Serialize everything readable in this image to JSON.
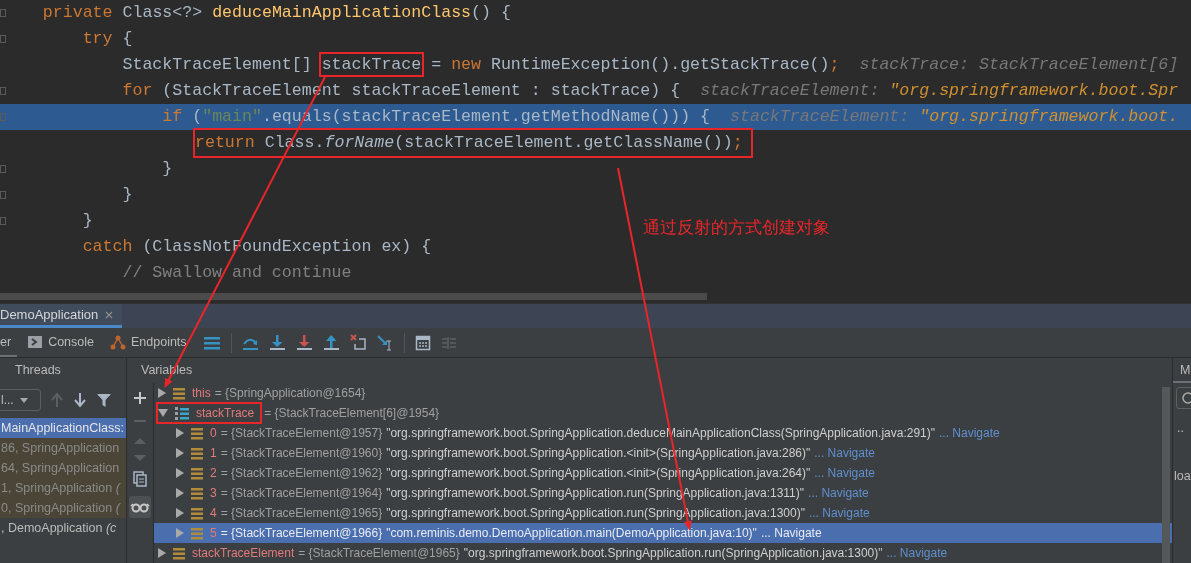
{
  "editor": {
    "lines": [
      {
        "foldable": true,
        "current": false,
        "boxed": false,
        "code": [
          {
            "t": "    private",
            "kind": "keyword"
          },
          {
            "t": " Class<?> ",
            "kind": "plain"
          },
          {
            "t": "deduceMainApplicationClass",
            "kind": "method"
          },
          {
            "t": "() {",
            "kind": "plain"
          }
        ]
      },
      {
        "foldable": true,
        "current": false,
        "boxed": false,
        "code": [
          {
            "t": "        try",
            "kind": "keyword"
          },
          {
            "t": " {",
            "kind": "plain"
          }
        ]
      },
      {
        "foldable": false,
        "current": false,
        "boxed": false,
        "code": [
          {
            "t": "            StackTraceElement[] ",
            "kind": "plain"
          },
          {
            "t": "stackTrace",
            "kind": "boxed"
          },
          {
            "t": " = ",
            "kind": "plain"
          },
          {
            "t": "new",
            "kind": "keyword"
          },
          {
            "t": " RuntimeException().getStackTrace()",
            "kind": "plain"
          },
          {
            "t": ";",
            "kind": "keyword"
          }
        ],
        "hint": [
          {
            "t": "stackTrace: ",
            "kind": "hint_name"
          },
          {
            "t": "StackTraceElement[6]",
            "kind": "hint_value"
          }
        ]
      },
      {
        "foldable": true,
        "current": false,
        "boxed": false,
        "code": [
          {
            "t": "            for",
            "kind": "keyword"
          },
          {
            "t": " (StackTraceElement stackTraceElement : stackTrace) {",
            "kind": "plain"
          }
        ],
        "hint": [
          {
            "t": "stackTraceElement: ",
            "kind": "hint_name"
          },
          {
            "t": "\"org.springframework.boot.Spr",
            "kind": "hint_string"
          }
        ]
      },
      {
        "foldable": true,
        "current": true,
        "boxed": false,
        "code": [
          {
            "t": "                if",
            "kind": "keyword"
          },
          {
            "t": " (",
            "kind": "plain"
          },
          {
            "t": "\"main\"",
            "kind": "string"
          },
          {
            "t": ".equals(stackTraceElement.getMethodName())) {",
            "kind": "plain"
          }
        ],
        "hint": [
          {
            "t": "stackTraceElement: ",
            "kind": "hint_name"
          },
          {
            "t": "\"org.springframework.boot.",
            "kind": "hint_string"
          }
        ]
      },
      {
        "foldable": false,
        "current": false,
        "boxed": true,
        "code": [
          {
            "t": "return",
            "kind": "keyword"
          },
          {
            "t": " Class.",
            "kind": "plain"
          },
          {
            "t": "forName",
            "kind": "static"
          },
          {
            "t": "(stackTraceElement.getClassName())",
            "kind": "plain"
          },
          {
            "t": ";",
            "kind": "keyword"
          }
        ]
      },
      {
        "foldable": true,
        "current": false,
        "boxed": false,
        "code": [
          {
            "t": "                }",
            "kind": "plain"
          }
        ]
      },
      {
        "foldable": true,
        "current": false,
        "boxed": false,
        "code": [
          {
            "t": "            }",
            "kind": "plain"
          }
        ]
      },
      {
        "foldable": true,
        "current": false,
        "boxed": false,
        "code": [
          {
            "t": "        }",
            "kind": "plain"
          }
        ]
      },
      {
        "foldable": false,
        "current": false,
        "boxed": false,
        "code": [
          {
            "t": "        catch",
            "kind": "keyword"
          },
          {
            "t": " (ClassNotFoundException ex) {",
            "kind": "plain"
          }
        ]
      },
      {
        "foldable": false,
        "current": false,
        "boxed": false,
        "code": [
          {
            "t": "            // Swallow and continue",
            "kind": "comment"
          }
        ]
      }
    ],
    "annotation": "通过反射的方式创建对象"
  },
  "debug": {
    "session_tab": {
      "label": "DemoApplication",
      "selected": true
    },
    "tabs": [
      {
        "label": "er",
        "selected": true
      },
      {
        "label": "Console",
        "selected": false
      },
      {
        "label": "Endpoints",
        "selected": false
      }
    ],
    "frames": {
      "header": "Threads",
      "dropdown": "l...",
      "items": [
        {
          "text": "MainApplicationClass:",
          "kind": "app",
          "selected": true
        },
        {
          "text": "86, SpringApplication",
          "kind": "library",
          "selected": false
        },
        {
          "text": "64, SpringApplication",
          "kind": "library",
          "selected": false
        },
        {
          "text": "1, SpringApplication *(*",
          "kind": "library",
          "selected": false
        },
        {
          "text": "0, SpringApplication *(*",
          "kind": "library",
          "selected": false
        },
        {
          "text": ", DemoApplication *(c*",
          "kind": "app",
          "selected": false
        }
      ]
    },
    "variables": {
      "header": "Variables",
      "rows": [
        {
          "name": "this",
          "value": "= {SpringApplication@1654}",
          "kind": "object",
          "expanded": false,
          "selected": false,
          "boxed": false
        },
        {
          "name": "stackTrace",
          "value": "= {StackTraceElement[6]@1954}",
          "kind": "array",
          "expanded": true,
          "selected": false,
          "boxed": true,
          "children": [
            {
              "name": "0",
              "value": "= {StackTraceElement@1957}",
              "string": "\"org.springframework.boot.SpringApplication.deduceMainApplicationClass(SpringApplication.java:291)\"",
              "link": "... Navigate",
              "kind": "object",
              "expanded": false,
              "selected": false,
              "boxed": false
            },
            {
              "name": "1",
              "value": "= {StackTraceElement@1960}",
              "string": "\"org.springframework.boot.SpringApplication.<init>(SpringApplication.java:286)\"",
              "link": "... Navigate",
              "kind": "object",
              "expanded": false,
              "selected": false,
              "boxed": false
            },
            {
              "name": "2",
              "value": "= {StackTraceElement@1962}",
              "string": "\"org.springframework.boot.SpringApplication.<init>(SpringApplication.java:264)\"",
              "link": "... Navigate",
              "kind": "object",
              "expanded": false,
              "selected": false,
              "boxed": false
            },
            {
              "name": "3",
              "value": "= {StackTraceElement@1964}",
              "string": "\"org.springframework.boot.SpringApplication.run(SpringApplication.java:1311)\"",
              "link": "... Navigate",
              "kind": "object",
              "expanded": false,
              "selected": false,
              "boxed": false
            },
            {
              "name": "4",
              "value": "= {StackTraceElement@1965}",
              "string": "\"org.springframework.boot.SpringApplication.run(SpringApplication.java:1300)\"",
              "link": "... Navigate",
              "kind": "object",
              "expanded": false,
              "selected": false,
              "boxed": false
            },
            {
              "name": "5",
              "value": "= {StackTraceElement@1966}",
              "string": "\"com.reminis.demo.DemoApplication.main(DemoApplication.java:10)\"",
              "link": "... Navigate",
              "kind": "object",
              "expanded": false,
              "selected": true,
              "boxed": false
            }
          ]
        },
        {
          "name": "stackTraceElement",
          "value": "= {StackTraceElement@1965}",
          "string": "\"org.springframework.boot.SpringApplication.run(SpringApplication.java:1300)\"",
          "link": "... Navigate",
          "kind": "object",
          "expanded": false,
          "selected": false,
          "boxed": false
        }
      ]
    },
    "side_panel": {
      "tab": "M",
      "text_1": "..",
      "text_2": "loa"
    }
  }
}
